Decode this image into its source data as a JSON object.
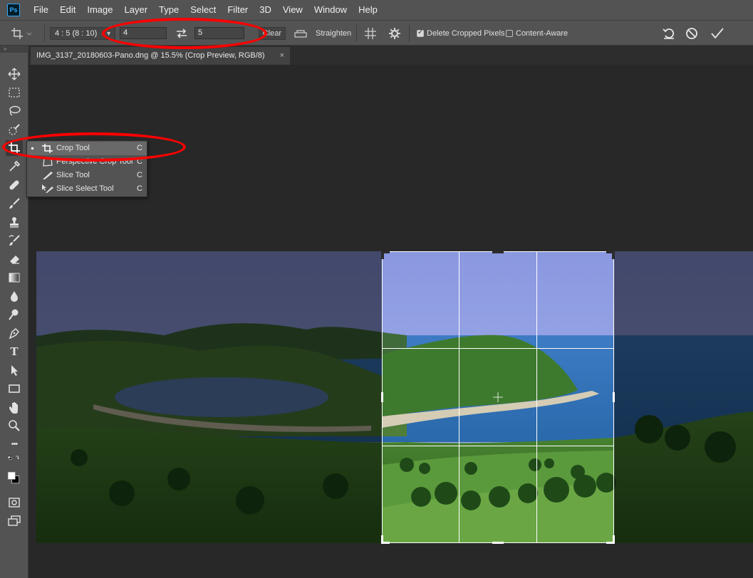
{
  "app": {
    "logo": "Ps"
  },
  "menu": [
    "File",
    "Edit",
    "Image",
    "Layer",
    "Type",
    "Select",
    "Filter",
    "3D",
    "View",
    "Window",
    "Help"
  ],
  "options": {
    "ratio_preset": "4 : 5 (8 : 10)",
    "width_value": "4",
    "height_value": "5",
    "clear_label": "Clear",
    "straighten_label": "Straighten",
    "delete_cropped_label": "Delete Cropped Pixels",
    "delete_cropped_checked": true,
    "content_aware_label": "Content-Aware",
    "content_aware_checked": false
  },
  "document": {
    "tab_title": "IMG_3137_20180603-Pano.dng @ 15.5% (Crop Preview, RGB/8)",
    "close_glyph": "×"
  },
  "flyout": {
    "items": [
      {
        "label": "Crop Tool",
        "key": "C",
        "active": true,
        "icon": "crop-icon"
      },
      {
        "label": "Perspective Crop Tool",
        "key": "C",
        "active": false,
        "icon": "perspective-crop-icon"
      },
      {
        "label": "Slice Tool",
        "key": "C",
        "active": false,
        "icon": "slice-icon"
      },
      {
        "label": "Slice Select Tool",
        "key": "C",
        "active": false,
        "icon": "slice-select-icon"
      }
    ]
  },
  "toolbar": {
    "collapse_glyph": "»",
    "tools": [
      "move-icon",
      "marquee-icon",
      "lasso-icon",
      "quick-select-icon",
      "crop-icon",
      "eyedropper-icon",
      "healing-icon",
      "brush-icon",
      "stamp-icon",
      "history-brush-icon",
      "eraser-icon",
      "gradient-icon",
      "blur-icon",
      "dodge-icon",
      "pen-icon",
      "type-icon",
      "path-select-icon",
      "rectangle-icon",
      "hand-icon",
      "zoom-icon",
      "more-icon",
      "swap-colors-icon",
      "color-swatches-icon",
      "quick-mask-icon",
      "screen-mode-icon"
    ],
    "type_glyph": "T",
    "more_glyph": "•••"
  },
  "colors": {
    "annotation": "#ff0000",
    "sky": "#8fa3e8",
    "sea": "#2f6fb3"
  }
}
